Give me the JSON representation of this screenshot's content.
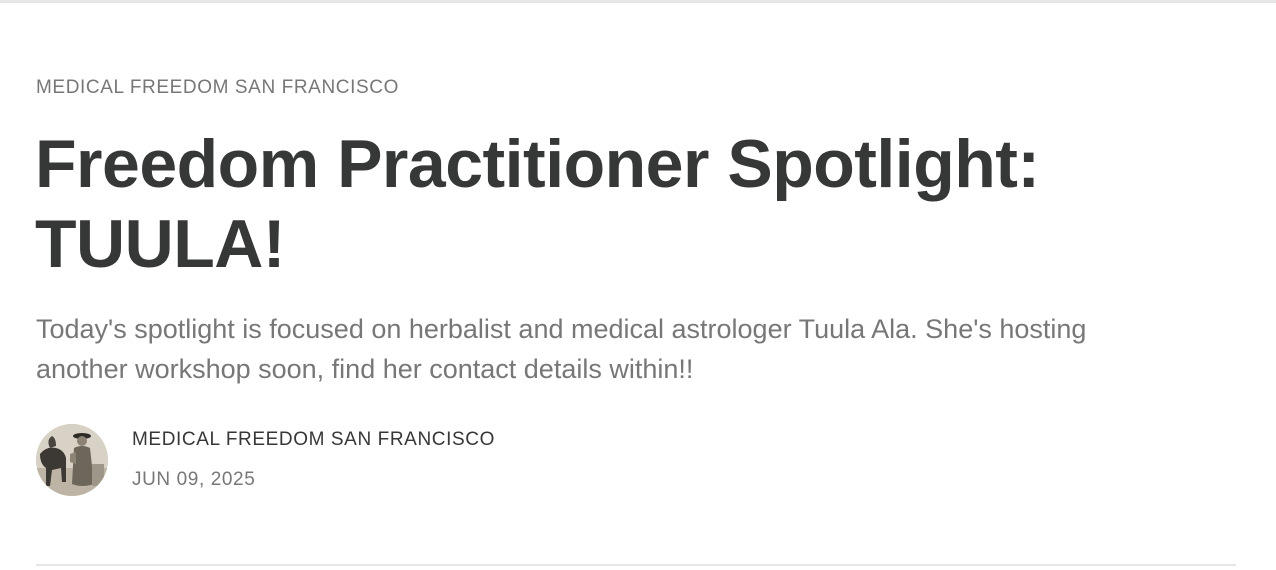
{
  "post": {
    "publication": "MEDICAL FREEDOM SAN FRANCISCO",
    "title": "Freedom Practitioner Spotlight: TUULA!",
    "subtitle": "Today's spotlight is focused on herbalist and medical astrologer Tuula Ala. She's hosting another workshop soon, find her contact details within!!",
    "author": {
      "name": "MEDICAL FREEDOM SAN FRANCISCO",
      "avatar_icon": "vintage-photo-avatar"
    },
    "date": "JUN 09, 2025"
  },
  "colors": {
    "heading": "#363737",
    "muted": "#777777",
    "rule": "#e6e6e6",
    "background": "#ffffff"
  }
}
